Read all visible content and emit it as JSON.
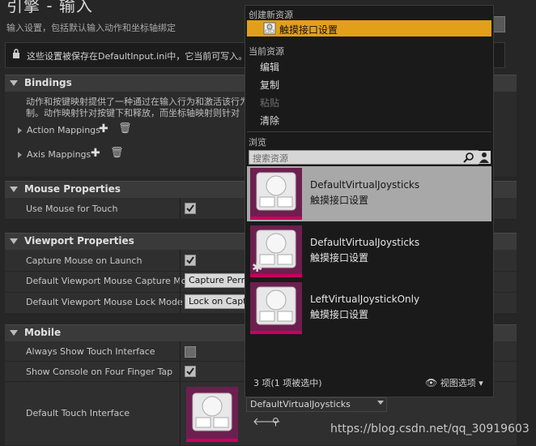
{
  "header": {
    "title": "引擎 - 输入",
    "subtitle": "输入设置，包括默认输入动作和坐标轴绑定",
    "notice": "这些设置被保存在DefaultInput.ini中，它当前可写入。"
  },
  "bindings": {
    "title": "Bindings",
    "description_line1": "动作和按键映射提供了一种通过在输入行为和激活该行为",
    "description_line2": "制。动作映射针对按键下和释放，而坐标轴映射则针对",
    "action_mappings": "Action Mappings",
    "axis_mappings": "Axis Mappings"
  },
  "mouse": {
    "title": "Mouse Properties",
    "use_mouse_for_touch": "Use Mouse for Touch",
    "use_mouse_for_touch_checked": true
  },
  "viewport": {
    "title": "Viewport Properties",
    "capture_mouse_on_launch": "Capture Mouse on Launch",
    "capture_mouse_on_launch_checked": true,
    "capture_mode_label": "Default Viewport Mouse Capture Mode",
    "capture_mode_value": "Capture Perm",
    "lock_mode_label": "Default Viewport Mouse Lock Mode",
    "lock_mode_value": "Lock on Captu"
  },
  "mobile": {
    "title": "Mobile",
    "always_show_touch": "Always Show Touch Interface",
    "always_show_touch_checked": false,
    "show_console": "Show Console on Four Finger Tap",
    "show_console_checked": true,
    "default_touch_interface": "Default Touch Interface",
    "touch_combo_value": "DefaultVirtualJoysticks"
  },
  "menu": {
    "create_header": "创建新资源",
    "create_item": "触摸接口设置",
    "current_header": "当前资源",
    "edit": "编辑",
    "copy": "复制",
    "paste": "粘贴",
    "clear": "清除",
    "browse_header": "浏览",
    "search_placeholder": "搜索资源",
    "assets": [
      {
        "name": "DefaultVirtualJoysticks",
        "type": "触摸接口设置"
      },
      {
        "name": "DefaultVirtualJoysticks",
        "type": "触摸接口设置"
      },
      {
        "name": "LeftVirtualJoystickOnly",
        "type": "触摸接口设置"
      }
    ],
    "footer": "3 项(1 项被选中)",
    "view_options": "视图选项"
  },
  "watermark": "https://blog.csdn.net/qq_30919603",
  "colors": {
    "selection": "#e2a01a",
    "thumb_bg": "#6d1f4f",
    "thumb_bar": "#c8005e"
  }
}
